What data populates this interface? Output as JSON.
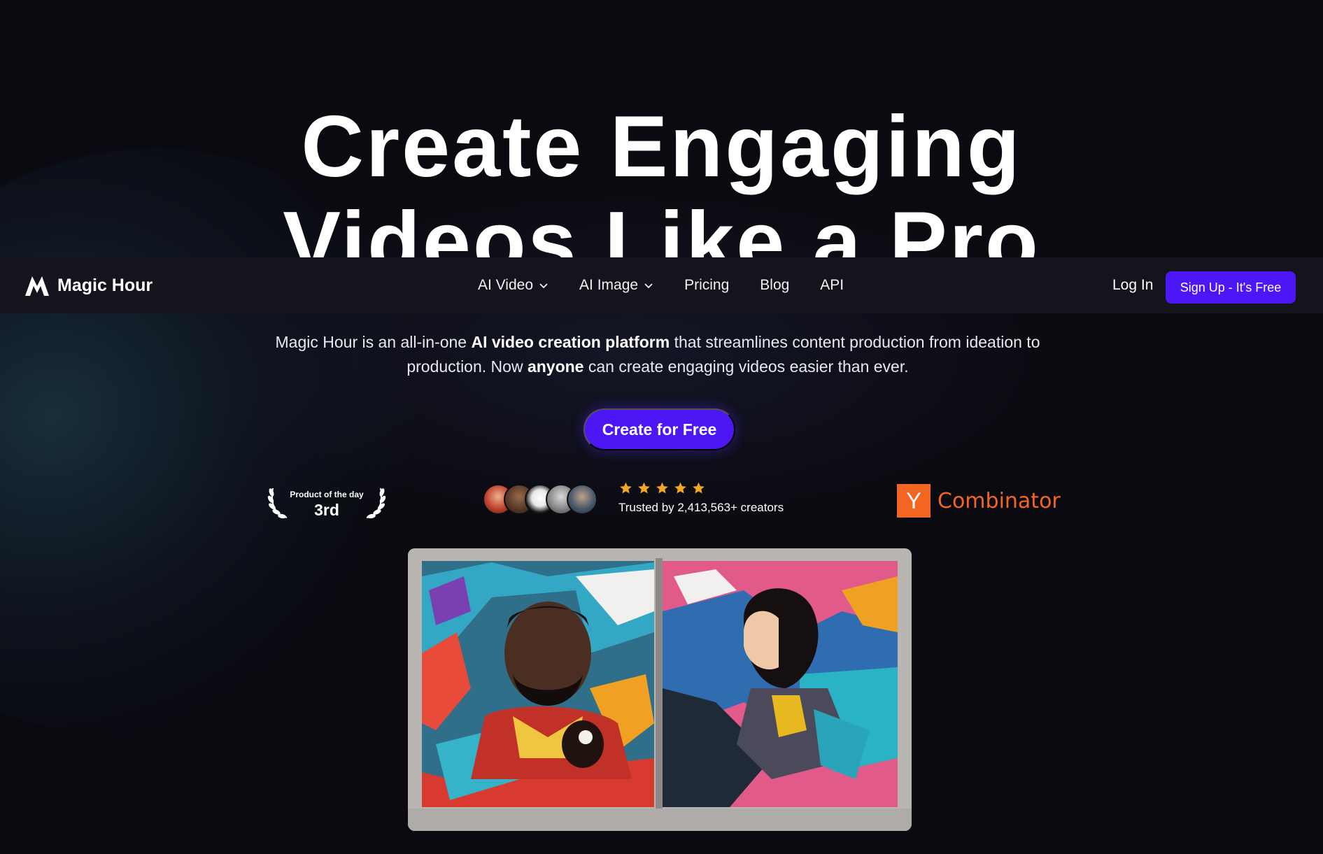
{
  "hero": {
    "line1": "Create Engaging",
    "line2": "Videos Like a Pro"
  },
  "navbar": {
    "brand_name": "Magic Hour",
    "items": [
      {
        "label": "AI Video",
        "dropdown": true
      },
      {
        "label": "AI Image",
        "dropdown": true
      },
      {
        "label": "Pricing",
        "dropdown": false
      },
      {
        "label": "Blog",
        "dropdown": false
      },
      {
        "label": "API",
        "dropdown": false
      }
    ],
    "login_label": "Log In",
    "signup_label": "Sign Up  - It's Free"
  },
  "description": {
    "part1": "Magic Hour is an all-in-one ",
    "bold1": "AI video creation platform",
    "part2": " that streamlines content production from ideation to production. Now ",
    "bold2": "anyone",
    "part3": " can create engaging videos easier than ever."
  },
  "cta_label": "Create for Free",
  "badges": {
    "product_of_the_day_label": "Product of the day",
    "product_of_the_day_rank": "3rd",
    "rating_stars": 5,
    "trusted_text": "Trusted by 2,413,563+ creators",
    "yc_letter": "Y",
    "yc_text": "Combinator"
  },
  "colors": {
    "accent": "#4d16f4",
    "background": "#0a0a10",
    "navbar": "#14141c",
    "star": "#f5a623",
    "yc_orange": "#f26622"
  },
  "icons": {
    "brand": "magic-hour-logo-icon",
    "dropdown": "chevron-down-icon",
    "laurel": "laurel-icon",
    "star": "star-icon"
  }
}
